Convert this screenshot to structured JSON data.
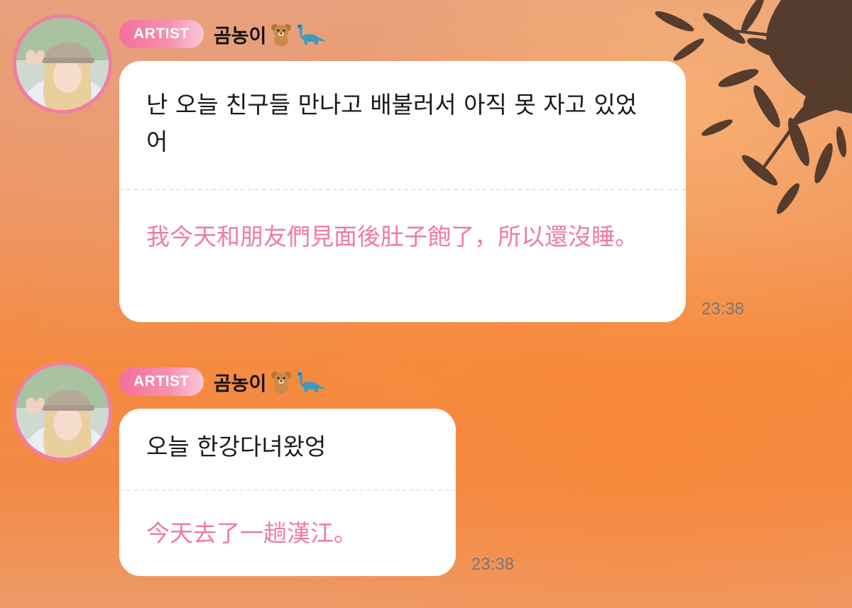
{
  "messages": [
    {
      "badge": "ARTIST",
      "sender": "곰농이",
      "sender_emoji": [
        "teddy-bear",
        "sauropod"
      ],
      "text_original": "난 오늘 친구들 만나고 배불러서 아직 못 자고 있었어",
      "text_translation": "我今天和朋友們見面後肚子飽了，所以還沒睡。",
      "time": "23:38"
    },
    {
      "badge": "ARTIST",
      "sender": "곰농이",
      "sender_emoji": [
        "teddy-bear",
        "sauropod"
      ],
      "text_original": "오늘 한강다녀왔엉",
      "text_translation": "今天去了一趟漢江。",
      "time": "23:38"
    }
  ],
  "colors": {
    "badge": "#f46f99",
    "translation_text": "#ee7ca0",
    "avatar_ring": "#f07ea3",
    "bubble": "#ffffff"
  }
}
